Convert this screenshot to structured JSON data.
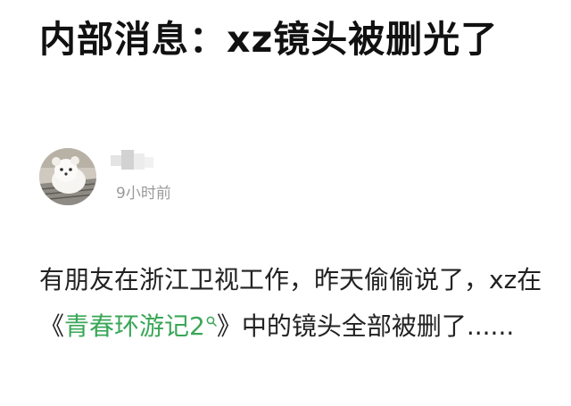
{
  "title": "内部消息：xz镜头被删光了",
  "author": {
    "time": "9小时前"
  },
  "body": {
    "text_before": "有朋友在浙江卫视工作，昨天偷偷说了，xz在《",
    "link_text": "青春环游记2",
    "text_after": "》中的镜头全部被删了......"
  },
  "colors": {
    "link": "#3aa757",
    "time": "#9a9a9a",
    "text": "#222222"
  },
  "icons": {
    "link_icon": "search-icon"
  }
}
